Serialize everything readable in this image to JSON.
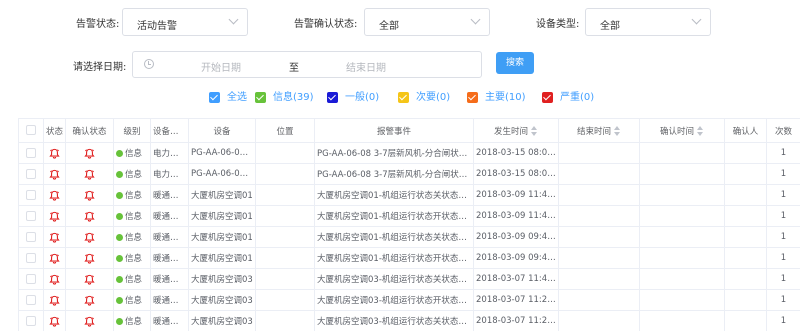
{
  "filters_form": {
    "alarm_status_label": "告警状态:",
    "alarm_status_value": "活动告警",
    "confirm_status_label": "告警确认状态:",
    "confirm_status_value": "全部",
    "device_type_label": "设备类型:",
    "device_type_value": "全部",
    "date_label": "请选择日期:",
    "start_placeholder": "开始日期",
    "date_separator": "至",
    "end_placeholder": "结束日期",
    "search_label": "搜索"
  },
  "level_filters": [
    {
      "label": "全选",
      "color": "#409eff"
    },
    {
      "label": "信息(39)",
      "color": "#67c23a"
    },
    {
      "label": "一般(0)",
      "color": "#1a1ad6"
    },
    {
      "label": "次要(0)",
      "color": "#f5c518"
    },
    {
      "label": "主要(10)",
      "color": "#f56c1a"
    },
    {
      "label": "严重(0)",
      "color": "#e02020"
    }
  ],
  "table": {
    "headers": {
      "status": "状态",
      "confirm_status": "确认状态",
      "level": "级别",
      "device_type": "设备类型",
      "device": "设备",
      "location": "位置",
      "event": "报警事件",
      "occur_time": "发生时间",
      "end_time": "结束时间",
      "confirm_time": "确认时间",
      "confirmer": "确认人",
      "count": "次数"
    },
    "rows": [
      {
        "level": "信息",
        "device_type": "电力设备",
        "device": "PG-AA-06-08 3-...",
        "location": "",
        "event": "PG-AA-06-08 3-7层新风机-分合闸状态状...",
        "occur_time": "2018-03-15 08:06:30",
        "end_time": "",
        "confirm_time": "",
        "confirmer": "",
        "count": "1"
      },
      {
        "level": "信息",
        "device_type": "电力设备",
        "device": "PG-AA-06-08 3-...",
        "location": "",
        "event": "PG-AA-06-08 3-7层新风机-分合闸状态状...",
        "occur_time": "2018-03-15 08:06:15",
        "end_time": "",
        "confirm_time": "",
        "confirmer": "",
        "count": "1"
      },
      {
        "level": "信息",
        "device_type": "暖通设备",
        "device": "大厦机房空调01",
        "location": "",
        "event": "大厦机房空调01-机组运行状态关状态通知",
        "occur_time": "2018-03-09 11:44:05",
        "end_time": "",
        "confirm_time": "",
        "confirmer": "",
        "count": "1"
      },
      {
        "level": "信息",
        "device_type": "暖通设备",
        "device": "大厦机房空调01",
        "location": "",
        "event": "大厦机房空调01-机组运行状态开状态通知",
        "occur_time": "2018-03-09 11:40:46",
        "end_time": "",
        "confirm_time": "",
        "confirmer": "",
        "count": "1"
      },
      {
        "level": "信息",
        "device_type": "暖通设备",
        "device": "大厦机房空调01",
        "location": "",
        "event": "大厦机房空调01-机组运行状态关状态通知",
        "occur_time": "2018-03-09 09:48:28",
        "end_time": "",
        "confirm_time": "",
        "confirmer": "",
        "count": "1"
      },
      {
        "level": "信息",
        "device_type": "暖通设备",
        "device": "大厦机房空调01",
        "location": "",
        "event": "大厦机房空调01-机组运行状态开状态通知",
        "occur_time": "2018-03-09 09:47:58",
        "end_time": "",
        "confirm_time": "",
        "confirmer": "",
        "count": "1"
      },
      {
        "level": "信息",
        "device_type": "暖通设备",
        "device": "大厦机房空调03",
        "location": "",
        "event": "大厦机房空调03-机组运行状态关状态通知",
        "occur_time": "2018-03-07 11:42:04",
        "end_time": "",
        "confirm_time": "",
        "confirmer": "",
        "count": "1"
      },
      {
        "level": "信息",
        "device_type": "暖通设备",
        "device": "大厦机房空调03",
        "location": "",
        "event": "大厦机房空调03-机组运行状态开状态通知",
        "occur_time": "2018-03-07 11:22:34",
        "end_time": "",
        "confirm_time": "",
        "confirmer": "",
        "count": "1"
      },
      {
        "level": "信息",
        "device_type": "暖通设备",
        "device": "大厦机房空调03",
        "location": "",
        "event": "大厦机房空调03-机组运行状态关状态通知",
        "occur_time": "2018-03-07 11:22:16",
        "end_time": "",
        "confirm_time": "",
        "confirmer": "",
        "count": "1"
      }
    ]
  },
  "colors": {
    "accent": "#409eff",
    "info_dot": "#67c23a",
    "bell": "#e02020"
  }
}
